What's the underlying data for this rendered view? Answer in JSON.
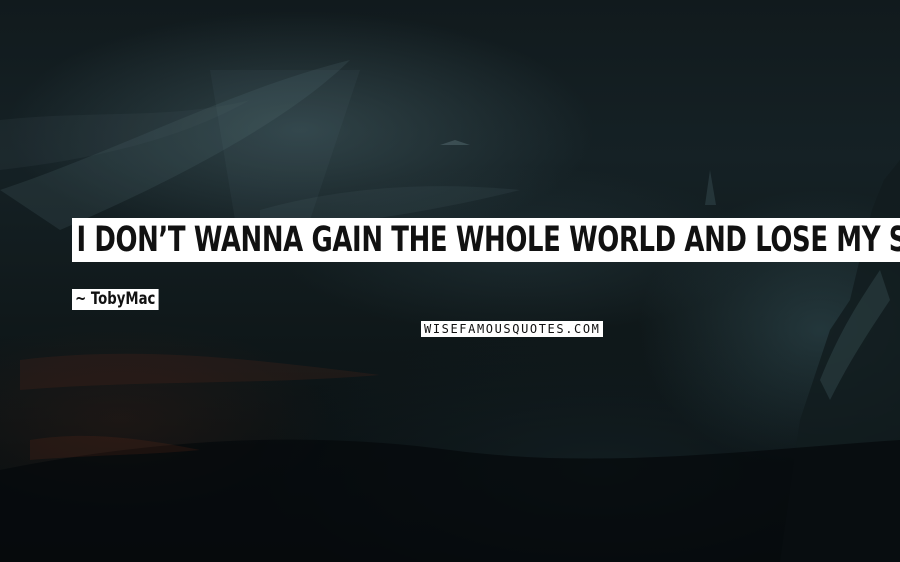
{
  "quote": {
    "text": "I don’t wanna gain the whole world and lose my soul."
  },
  "author": {
    "text": "~ TobyMac"
  },
  "watermark": {
    "text": "WISEFAMOUSQUOTES.COM"
  },
  "colors": {
    "background": "#0b1214",
    "highlight": "#ffffff",
    "text": "#111111"
  }
}
